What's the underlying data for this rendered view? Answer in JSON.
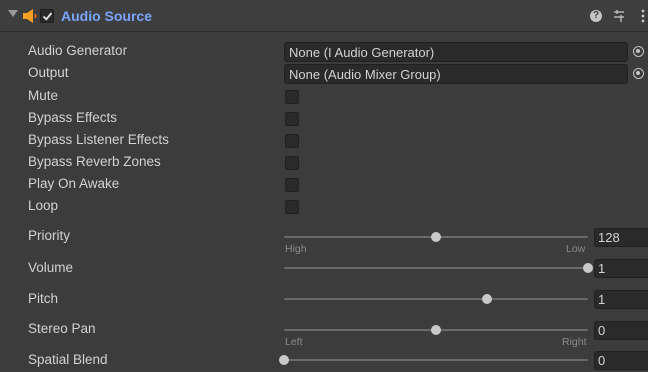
{
  "component": {
    "title": "Audio Source",
    "enabled": true,
    "icons": [
      "fold-arrow-icon",
      "speaker-icon",
      "help-icon",
      "preset-icon",
      "menu-icon"
    ]
  },
  "fields": {
    "audio_generator": {
      "label": "Audio Generator",
      "value": "None (I Audio Generator)"
    },
    "output": {
      "label": "Output",
      "value": "None (Audio Mixer Group)"
    },
    "mute": {
      "label": "Mute",
      "checked": false
    },
    "bypass_effects": {
      "label": "Bypass Effects",
      "checked": false
    },
    "bypass_listener_effects": {
      "label": "Bypass Listener Effects",
      "checked": false
    },
    "bypass_reverb_zones": {
      "label": "Bypass Reverb Zones",
      "checked": false
    },
    "play_on_awake": {
      "label": "Play On Awake",
      "checked": false
    },
    "loop": {
      "label": "Loop",
      "checked": false
    },
    "priority": {
      "label": "Priority",
      "value": "128",
      "min_label": "High",
      "max_label": "Low",
      "fraction": 0.5
    },
    "volume": {
      "label": "Volume",
      "value": "1",
      "fraction": 1.0
    },
    "pitch": {
      "label": "Pitch",
      "value": "1",
      "fraction": 0.667
    },
    "stereo_pan": {
      "label": "Stereo Pan",
      "value": "0",
      "min_label": "Left",
      "max_label": "Right",
      "fraction": 0.5
    },
    "spatial_blend": {
      "label": "Spatial Blend",
      "value": "0",
      "fraction": 0.0
    }
  },
  "colors": {
    "title": "#79a5ff",
    "background": "#3c3c3c",
    "field": "#2a2a2a"
  }
}
